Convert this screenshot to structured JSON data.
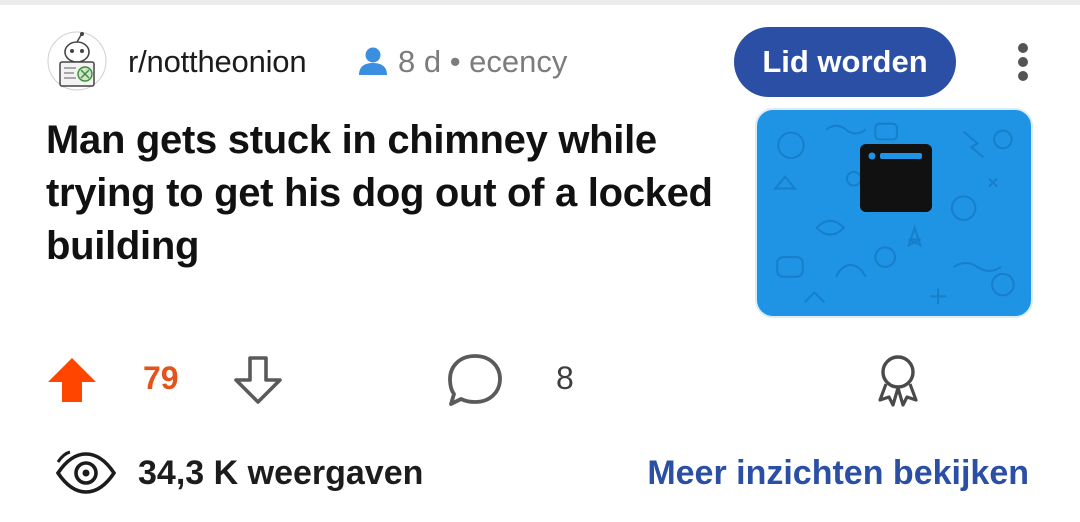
{
  "header": {
    "subreddit": "r/nottheonion",
    "meta": "8 d • ecency",
    "join_label": "Lid worden"
  },
  "post": {
    "title": "Man gets stuck in chimney while trying to get his dog out of a locked building"
  },
  "actions": {
    "score": "79",
    "comments": "8"
  },
  "stats": {
    "views": "34,3 K weergaven",
    "insights_label": "Meer inzichten bekijken"
  },
  "icons": {
    "avatar": "subreddit-avatar-icon",
    "user": "user-icon",
    "more": "more-options-icon",
    "upvote": "upvote-arrow-icon",
    "downvote": "downvote-arrow-icon",
    "comment": "comment-bubble-icon",
    "award": "award-icon",
    "views": "eye-icon",
    "thumbnail": "link-thumbnail-icon"
  },
  "colors": {
    "upvote": "#ff4500",
    "score": "#e3541c",
    "accent": "#2a4fa4",
    "thumbnail_bg": "#1f93e4"
  }
}
